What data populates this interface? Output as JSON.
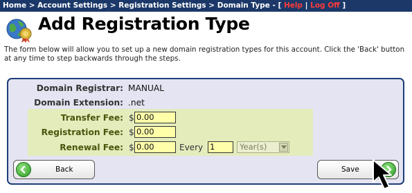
{
  "breadcrumb": {
    "path": "Home > Account Settings > Registration Settings > Domain Type - [",
    "help": "Help",
    "sep": "|",
    "logoff": "Log Off",
    "close": "]"
  },
  "page": {
    "title": "Add Registration Type",
    "intro": "The form below will allow you to set up a new domain registration types for this account. Click the 'Back' button at any time to step backwards through the steps."
  },
  "form": {
    "registrar_label": "Domain Registrar:",
    "registrar_value": "MANUAL",
    "extension_label": "Domain Extension:",
    "extension_value": ".net",
    "currency": "$",
    "transfer_label": "Transfer Fee:",
    "transfer_value": "0.00",
    "registration_label": "Registration Fee:",
    "registration_value": "0.00",
    "renewal_label": "Renewal Fee:",
    "renewal_value": "0.00",
    "every_label": "Every",
    "every_value": "1",
    "period_selected": "Year(s)"
  },
  "buttons": {
    "back": "Back",
    "save": "Save"
  },
  "icons": {
    "title": "globe-with-badge-icon",
    "back": "arrow-left-circle-icon",
    "save": "arrow-right-circle-icon",
    "cursor": "mouse-pointer-icon"
  }
}
